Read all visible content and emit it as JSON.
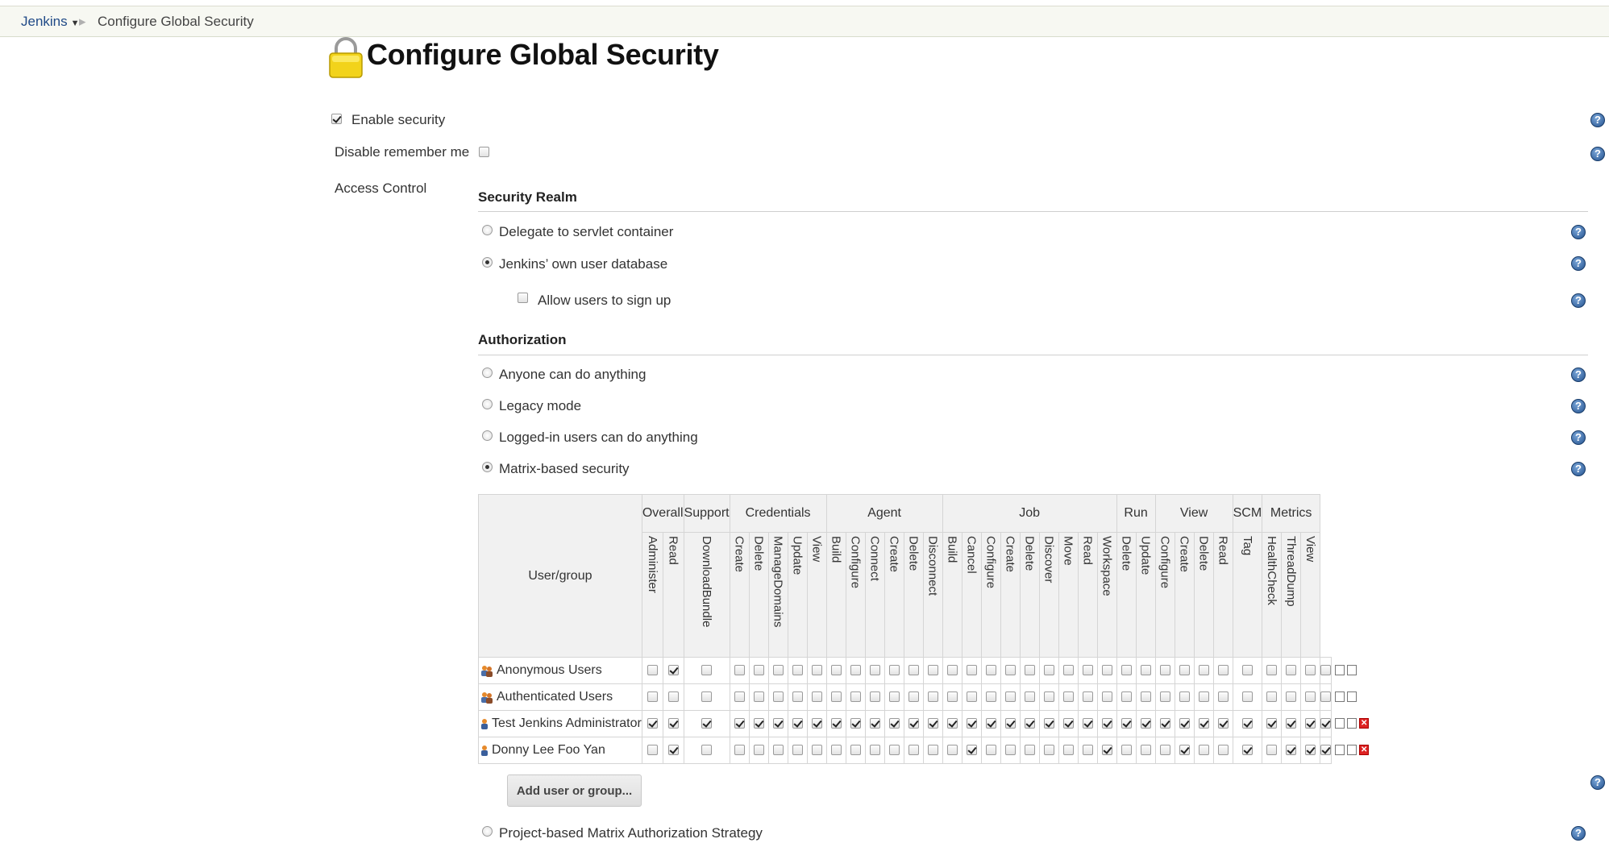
{
  "breadcrumb": {
    "home": "Jenkins",
    "current": "Configure Global Security"
  },
  "page_title": "Configure Global Security",
  "enable_security": {
    "label": "Enable security",
    "checked": true
  },
  "disable_remember_me": {
    "label": "Disable remember me",
    "checked": false
  },
  "access_control_label": "Access Control",
  "security_realm": {
    "heading": "Security Realm",
    "options": [
      {
        "label": "Delegate to servlet container",
        "selected": false
      },
      {
        "label": "Jenkins’ own user database",
        "selected": true
      }
    ],
    "allow_signup": {
      "label": "Allow users to sign up",
      "checked": false
    }
  },
  "authorization": {
    "heading": "Authorization",
    "options": [
      {
        "label": "Anyone can do anything",
        "selected": false
      },
      {
        "label": "Legacy mode",
        "selected": false
      },
      {
        "label": "Logged-in users can do anything",
        "selected": false
      },
      {
        "label": "Matrix-based security",
        "selected": true
      }
    ],
    "project_matrix": {
      "label": "Project-based Matrix Authorization Strategy",
      "selected": false
    }
  },
  "matrix": {
    "user_group_header": "User/group",
    "groups": [
      {
        "name": "Overall",
        "permissions": [
          "Administer",
          "Read"
        ]
      },
      {
        "name": "Support",
        "permissions": [
          "DownloadBundle"
        ]
      },
      {
        "name": "Credentials",
        "permissions": [
          "Create",
          "Delete",
          "ManageDomains",
          "Update",
          "View"
        ]
      },
      {
        "name": "Agent",
        "permissions": [
          "Build",
          "Configure",
          "Connect",
          "Create",
          "Delete",
          "Disconnect"
        ]
      },
      {
        "name": "Job",
        "permissions": [
          "Build",
          "Cancel",
          "Configure",
          "Create",
          "Delete",
          "Discover",
          "Move",
          "Read",
          "Workspace"
        ]
      },
      {
        "name": "Run",
        "permissions": [
          "Delete",
          "Update"
        ]
      },
      {
        "name": "View",
        "permissions": [
          "Configure",
          "Create",
          "Delete",
          "Read"
        ]
      },
      {
        "name": "SCM",
        "permissions": [
          "Tag"
        ]
      },
      {
        "name": "Metrics",
        "permissions": [
          "HealthCheck",
          "ThreadDump",
          "View"
        ]
      }
    ],
    "rows": [
      {
        "name": "Anonymous Users",
        "type": "group",
        "deletable": false,
        "checks": [
          0,
          1,
          0,
          0,
          0,
          0,
          0,
          0,
          0,
          0,
          0,
          0,
          0,
          0,
          0,
          0,
          0,
          0,
          0,
          0,
          0,
          0,
          0,
          0,
          0,
          0,
          0,
          0,
          0,
          0,
          0,
          0,
          0,
          0
        ]
      },
      {
        "name": "Authenticated Users",
        "type": "group",
        "deletable": false,
        "checks": [
          0,
          0,
          0,
          0,
          0,
          0,
          0,
          0,
          0,
          0,
          0,
          0,
          0,
          0,
          0,
          0,
          0,
          0,
          0,
          0,
          0,
          0,
          0,
          0,
          0,
          0,
          0,
          0,
          0,
          0,
          0,
          0,
          0,
          0
        ]
      },
      {
        "name": "Test Jenkins Administrator",
        "type": "user",
        "deletable": true,
        "checks": [
          1,
          1,
          1,
          1,
          1,
          1,
          1,
          1,
          1,
          1,
          1,
          1,
          1,
          1,
          1,
          1,
          1,
          1,
          1,
          1,
          1,
          1,
          1,
          1,
          1,
          1,
          1,
          1,
          1,
          1,
          1,
          1,
          1,
          1
        ]
      },
      {
        "name": "Donny Lee Foo Yan",
        "type": "user",
        "deletable": true,
        "checks": [
          0,
          1,
          0,
          0,
          0,
          0,
          0,
          0,
          0,
          0,
          0,
          0,
          0,
          0,
          0,
          1,
          0,
          0,
          0,
          0,
          0,
          0,
          1,
          0,
          0,
          0,
          1,
          0,
          0,
          1,
          0,
          1,
          1,
          1
        ]
      }
    ],
    "add_button": "Add user or group..."
  },
  "colors": {
    "breadcrumb_bg": "#f7f8f2",
    "help_icon": "#24528f",
    "delete_icon": "#dd2222"
  }
}
